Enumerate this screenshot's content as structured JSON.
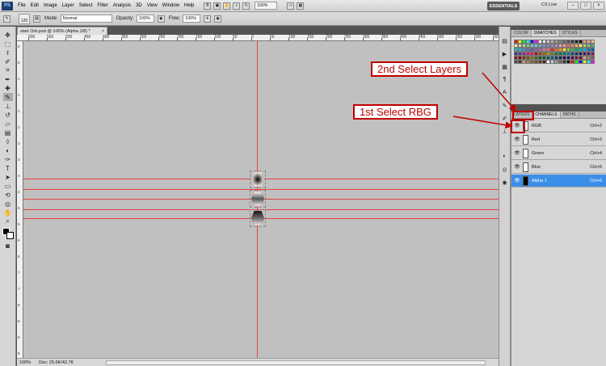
{
  "menubar": {
    "logo": "PS",
    "items": [
      "File",
      "Edit",
      "Image",
      "Layer",
      "Select",
      "Filter",
      "Analysis",
      "3D",
      "View",
      "Window",
      "Help"
    ],
    "zoom": "100%",
    "workspace": "ESSENTIALS",
    "cs_live": "CS Live"
  },
  "optbar": {
    "brush_size": "120",
    "mode_label": "Mode:",
    "mode_value": "Normal",
    "opacity_label": "Opacity:",
    "opacity_value": "100%",
    "flow_label": "Flow:",
    "flow_value": "100%"
  },
  "document": {
    "tab_title": "start Orb.psd @ 100% (Alpha 1/8) *",
    "tab_close": "×",
    "ruler_top": [
      "600",
      "550",
      "500",
      "450",
      "400",
      "350",
      "300",
      "250",
      "200",
      "150",
      "100",
      "50",
      "0",
      "50",
      "100",
      "150",
      "200",
      "250",
      "300",
      "350",
      "400",
      "450",
      "500",
      "550",
      "600",
      "650"
    ],
    "ruler_left": [
      "0",
      "5",
      "1",
      "1",
      "2",
      "2",
      "3",
      "3",
      "4",
      "4",
      "5",
      "5",
      "6",
      "6",
      "7",
      "7",
      "8",
      "8",
      "9",
      "9"
    ]
  },
  "status": {
    "zoom": "100%",
    "doc_info": "Doc: 25.6K/42.7K"
  },
  "swatch_panel": {
    "tabs": [
      "COLOR",
      "SWATCHES",
      "STYLES"
    ],
    "active_tab": "SWATCHES"
  },
  "channels_panel": {
    "tabs": [
      "LAYERS",
      "CHANNELS",
      "PATHS"
    ],
    "active_tab": "CHANNELS",
    "rows": [
      {
        "name": "RGB",
        "shortcut": "Ctrl+2"
      },
      {
        "name": "Red",
        "shortcut": "Ctrl+3"
      },
      {
        "name": "Green",
        "shortcut": "Ctrl+4"
      },
      {
        "name": "Blue",
        "shortcut": "Ctrl+5"
      },
      {
        "name": "Alpha 1",
        "shortcut": "Ctrl+6"
      }
    ]
  },
  "annotations": {
    "first": "1st Select RBG",
    "second": "2nd Select Layers",
    "accent": "#c00000"
  },
  "colors": {
    "guide": "#e34444",
    "canvas": "#c0c0c0",
    "selection": "#3c8fe8"
  }
}
